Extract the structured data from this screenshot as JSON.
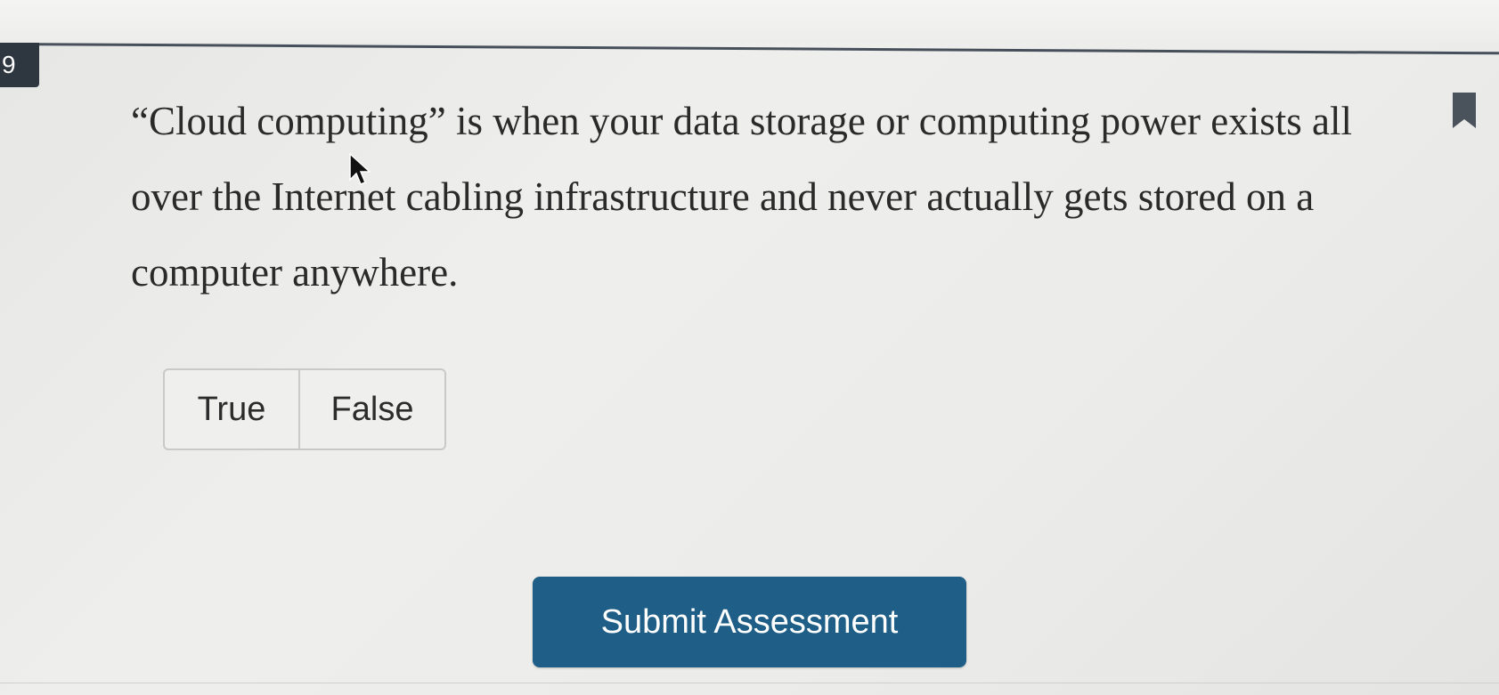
{
  "question": {
    "number": "9",
    "text": "“Cloud computing” is when your data storage or computing power exists all over the Internet cabling infrastructure and never actually gets stored on a computer anywhere."
  },
  "answer_choices": [
    "True",
    "False"
  ],
  "submit_button": {
    "label": "Submit Assessment"
  },
  "icons": {
    "bookmark": "bookmark-icon",
    "cursor": "mouse-pointer-icon"
  },
  "colors": {
    "submit_button": "#1f5e86",
    "badge": "#2e3640",
    "divider": "#47505a"
  }
}
